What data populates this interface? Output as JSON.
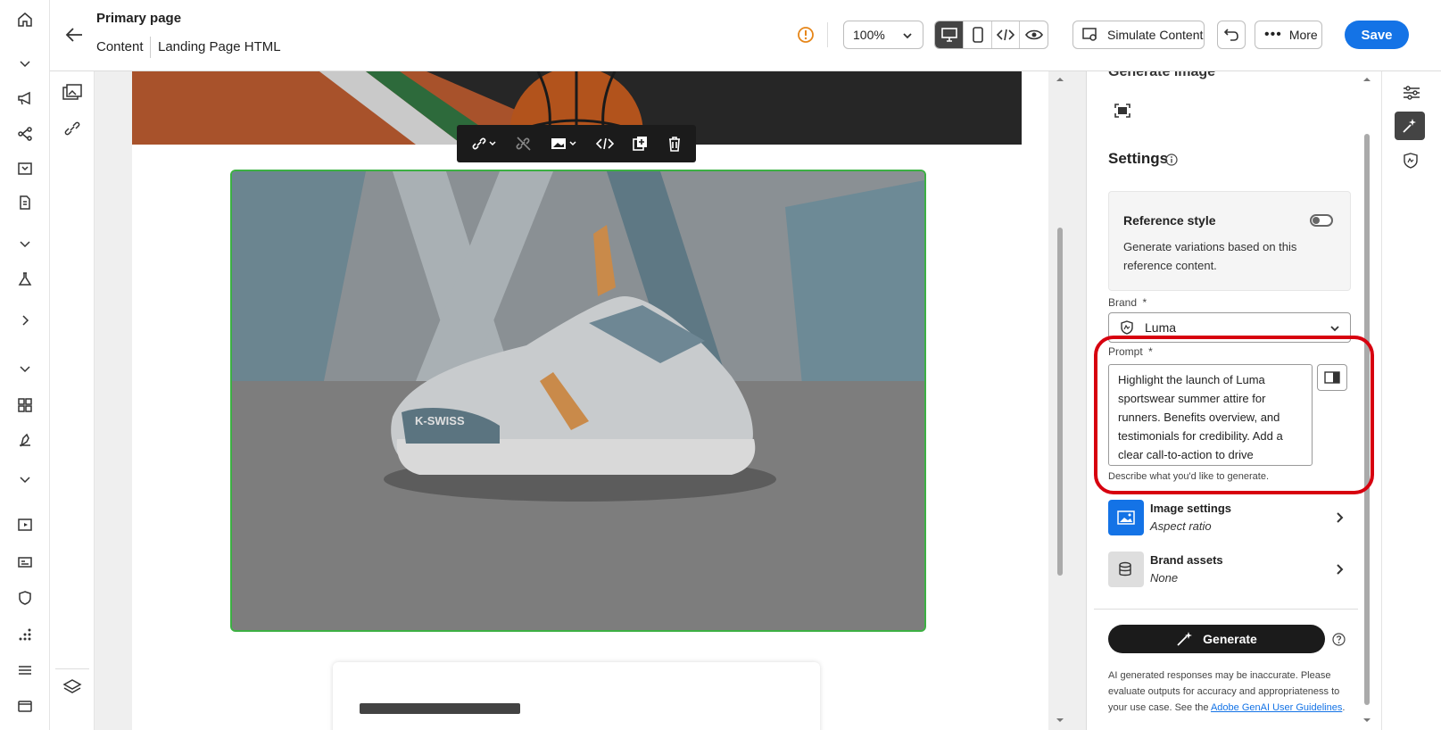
{
  "header": {
    "title": "Primary page",
    "breadcrumb": [
      "Content",
      "Landing Page HTML"
    ],
    "zoom": "100%",
    "simulate_label": "Simulate Content",
    "more_label": "More",
    "save_label": "Save"
  },
  "canvas": {
    "shoe_brand_text": "K-SWISS"
  },
  "panel": {
    "section_title": "Generate image",
    "settings_title": "Settings",
    "reference": {
      "title": "Reference style",
      "description": "Generate variations based on this reference content.",
      "enabled": false
    },
    "brand": {
      "label": "Brand",
      "required_mark": "*",
      "value": "Luma"
    },
    "prompt": {
      "label": "Prompt",
      "required_mark": "*",
      "value": "Highlight the launch of Luma sportswear summer attire for runners. Benefits overview, and testimonials for credibility. Add a clear call-to-action to drive",
      "help": "Describe what you'd like to generate."
    },
    "image_settings": {
      "title": "Image settings",
      "subtitle": "Aspect ratio"
    },
    "brand_assets": {
      "title": "Brand assets",
      "subtitle": "None"
    },
    "generate_label": "Generate",
    "disclaimer": "AI generated responses may be inaccurate. Please evaluate outputs for accuracy and appropriateness to your use case. See the",
    "disclaimer_link": "Adobe GenAI User Guidelines",
    "disclaimer_end": "."
  },
  "colors": {
    "accent": "#1473e6",
    "highlight": "#d7000f",
    "selection": "#3cb043"
  }
}
